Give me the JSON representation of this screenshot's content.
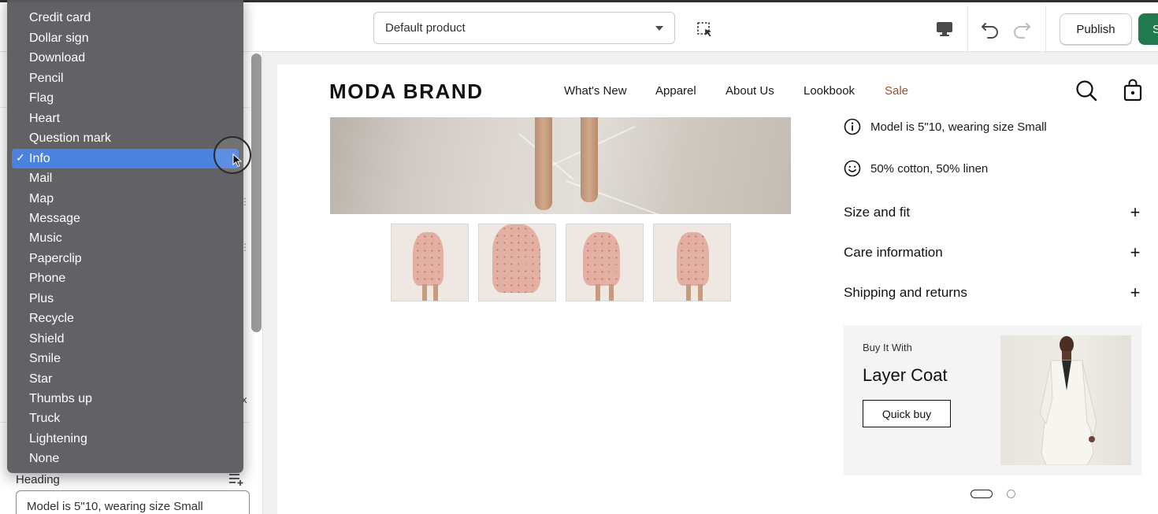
{
  "toolbar": {
    "template_select": "Default product",
    "publish_label": "Publish",
    "save_label": "S"
  },
  "icon_menu": {
    "selected_marker": "✓",
    "items": [
      "Credit card",
      "Dollar sign",
      "Download",
      "Pencil",
      "Flag",
      "Heart",
      "Question mark",
      "Info",
      "Mail",
      "Map",
      "Message",
      "Music",
      "Paperclip",
      "Phone",
      "Plus",
      "Recycle",
      "Shield",
      "Smile",
      "Star",
      "Thumbs up",
      "Truck",
      "Lightening",
      "None"
    ],
    "selected": "Info"
  },
  "settings": {
    "truncated_char": "x",
    "heading_label": "Heading",
    "heading_value": "Model is 5\"10, wearing size Small"
  },
  "store": {
    "brand": "MODA BRAND",
    "nav": [
      "What's New",
      "Apparel",
      "About Us",
      "Lookbook",
      "Sale"
    ],
    "sale_color": "#a0522d",
    "features": [
      {
        "icon": "info-icon",
        "text": "Model is 5\"10, wearing size Small"
      },
      {
        "icon": "smile-icon",
        "text": "50% cotton, 50% linen"
      }
    ],
    "accordions": [
      "Size and fit",
      "Care information",
      "Shipping and returns"
    ],
    "upsell": {
      "kicker": "Buy It With",
      "title": "Layer Coat",
      "button": "Quick buy"
    }
  },
  "colors": {
    "accent_selected": "#4b82e0",
    "publish_green": "#1f7a4f"
  }
}
